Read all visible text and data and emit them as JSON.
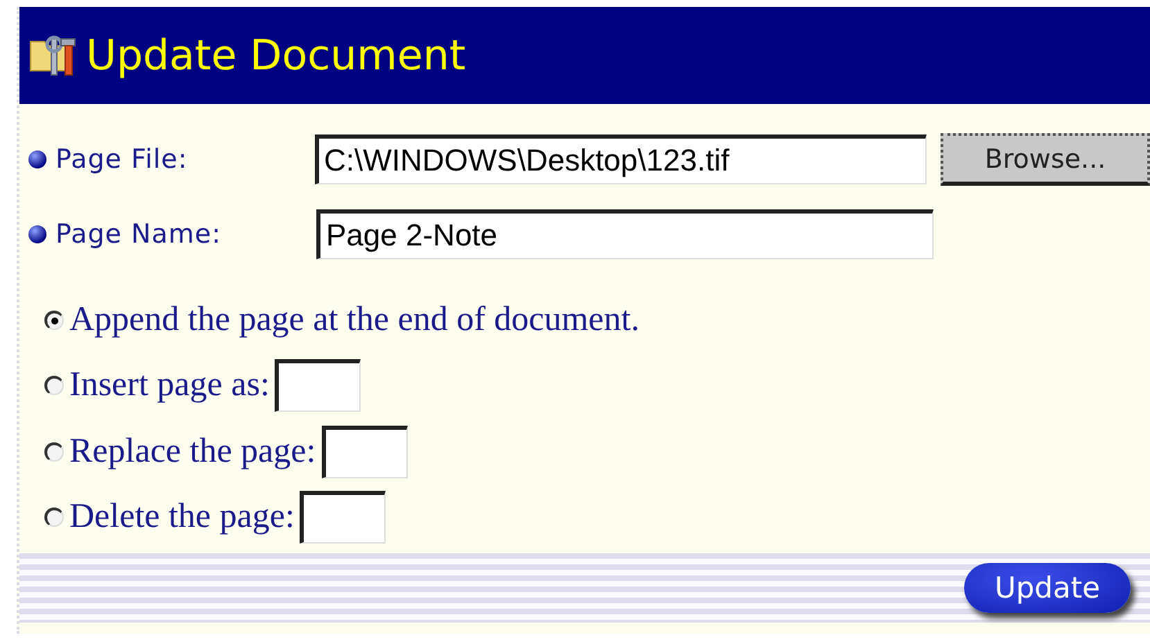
{
  "header": {
    "title": "Update Document"
  },
  "fields": [
    {
      "label": "Page File:",
      "value": "C:\\WINDOWS\\Desktop\\123.tif",
      "button": "Browse..."
    },
    {
      "label": "Page Name:",
      "value": "Page 2-Note"
    }
  ],
  "options": [
    {
      "label": "Append the page at the end of document.",
      "selected": true,
      "kind": "plain"
    },
    {
      "label": "Insert page as:",
      "selected": false,
      "kind": "number"
    },
    {
      "label": "Replace the page:",
      "selected": false,
      "kind": "number"
    },
    {
      "label": "Delete the page:",
      "selected": false,
      "kind": "number"
    }
  ],
  "submit": "Update"
}
